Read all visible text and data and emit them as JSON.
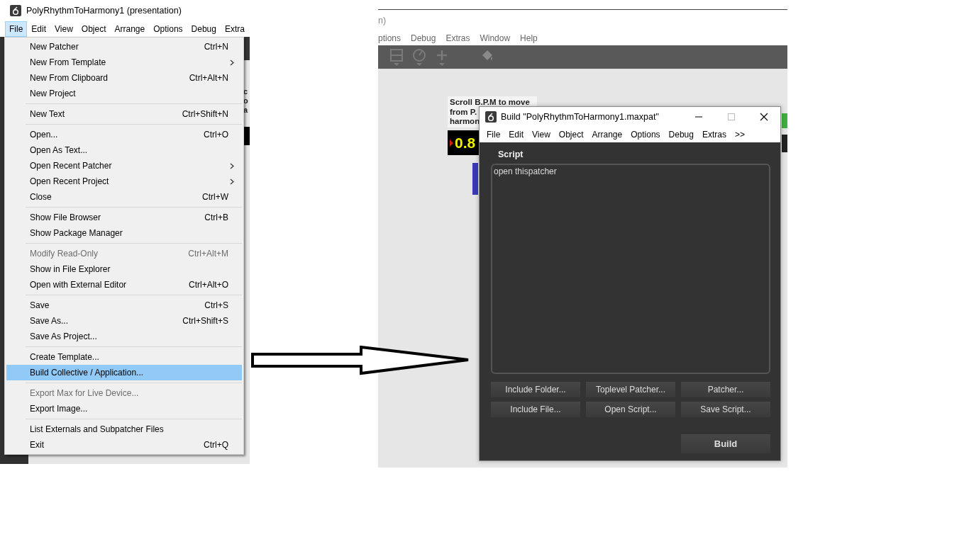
{
  "left_window": {
    "title": "PolyRhythmToHarmony1 (presentation)",
    "menu_bar": [
      {
        "label": "File",
        "selected": true
      },
      {
        "label": "Edit",
        "selected": false
      },
      {
        "label": "View",
        "selected": false
      },
      {
        "label": "Object",
        "selected": false
      },
      {
        "label": "Arrange",
        "selected": false
      },
      {
        "label": "Options",
        "selected": false
      },
      {
        "label": "Debug",
        "selected": false
      },
      {
        "label": "Extra",
        "selected": false
      }
    ],
    "background_fragment": [
      "c",
      "o",
      "a"
    ],
    "file_menu": [
      {
        "kind": "item",
        "label": "New Patcher",
        "shortcut": "Ctrl+N",
        "submenu": false,
        "disabled": false,
        "selected": false
      },
      {
        "kind": "item",
        "label": "New From Template",
        "submenu": true,
        "disabled": false,
        "selected": false
      },
      {
        "kind": "item",
        "label": "New From Clipboard",
        "shortcut": "Ctrl+Alt+N",
        "submenu": false,
        "disabled": false,
        "selected": false
      },
      {
        "kind": "item",
        "label": "New Project",
        "submenu": false,
        "disabled": false,
        "selected": false
      },
      {
        "kind": "separator"
      },
      {
        "kind": "item",
        "label": "New Text",
        "shortcut": "Ctrl+Shift+N",
        "submenu": false,
        "disabled": false,
        "selected": false
      },
      {
        "kind": "separator"
      },
      {
        "kind": "item",
        "label": "Open...",
        "shortcut": "Ctrl+O",
        "submenu": false,
        "disabled": false,
        "selected": false
      },
      {
        "kind": "item",
        "label": "Open As Text...",
        "submenu": false,
        "disabled": false,
        "selected": false
      },
      {
        "kind": "item",
        "label": "Open Recent Patcher",
        "submenu": true,
        "disabled": false,
        "selected": false
      },
      {
        "kind": "item",
        "label": "Open Recent Project",
        "submenu": true,
        "disabled": false,
        "selected": false
      },
      {
        "kind": "item",
        "label": "Close",
        "shortcut": "Ctrl+W",
        "submenu": false,
        "disabled": false,
        "selected": false
      },
      {
        "kind": "separator"
      },
      {
        "kind": "item",
        "label": "Show File Browser",
        "shortcut": "Ctrl+B",
        "submenu": false,
        "disabled": false,
        "selected": false
      },
      {
        "kind": "item",
        "label": "Show Package Manager",
        "submenu": false,
        "disabled": false,
        "selected": false
      },
      {
        "kind": "separator"
      },
      {
        "kind": "item",
        "label": "Modify Read-Only",
        "shortcut": "Ctrl+Alt+M",
        "submenu": false,
        "disabled": true,
        "selected": false
      },
      {
        "kind": "item",
        "label": "Show in File Explorer",
        "submenu": false,
        "disabled": false,
        "selected": false
      },
      {
        "kind": "item",
        "label": "Open with External Editor",
        "shortcut": "Ctrl+Alt+O",
        "submenu": false,
        "disabled": false,
        "selected": false
      },
      {
        "kind": "separator"
      },
      {
        "kind": "item",
        "label": "Save",
        "shortcut": "Ctrl+S",
        "submenu": false,
        "disabled": false,
        "selected": false
      },
      {
        "kind": "item",
        "label": "Save As...",
        "shortcut": "Ctrl+Shift+S",
        "submenu": false,
        "disabled": false,
        "selected": false
      },
      {
        "kind": "item",
        "label": "Save As Project...",
        "submenu": false,
        "disabled": false,
        "selected": false
      },
      {
        "kind": "separator"
      },
      {
        "kind": "item",
        "label": "Create Template...",
        "submenu": false,
        "disabled": false,
        "selected": false
      },
      {
        "kind": "item",
        "label": "Build Collective / Application...",
        "submenu": false,
        "disabled": false,
        "selected": true
      },
      {
        "kind": "separator"
      },
      {
        "kind": "item",
        "label": "Export Max for Live Device...",
        "submenu": false,
        "disabled": true,
        "selected": false
      },
      {
        "kind": "item",
        "label": "Export Image...",
        "submenu": false,
        "disabled": false,
        "selected": false
      },
      {
        "kind": "separator"
      },
      {
        "kind": "item",
        "label": "List Externals and Subpatcher Files",
        "submenu": false,
        "disabled": false,
        "selected": false
      },
      {
        "kind": "item",
        "label": "Exit",
        "shortcut": "Ctrl+Q",
        "submenu": false,
        "disabled": false,
        "selected": false
      }
    ]
  },
  "right_window": {
    "title": "n)",
    "menu_bar": [
      "ptions",
      "Debug",
      "Extras",
      "Window",
      "Help"
    ],
    "comment_lines": [
      "Scroll B.P.M to move",
      "from P.",
      "harmon"
    ],
    "number": "0.8"
  },
  "build_window": {
    "title": "Build \"PolyRhythmToHarmony1.maxpat\"",
    "menu_bar": [
      "File",
      "Edit",
      "View",
      "Object",
      "Arrange",
      "Options",
      "Debug",
      "Extras",
      ">>"
    ],
    "section_label": "Script",
    "script": "open thispatcher",
    "buttons": [
      "Include Folder...",
      "Toplevel Patcher...",
      "Patcher...",
      "Include File...",
      "Open Script...",
      "Save Script..."
    ],
    "build_button": "Build"
  }
}
